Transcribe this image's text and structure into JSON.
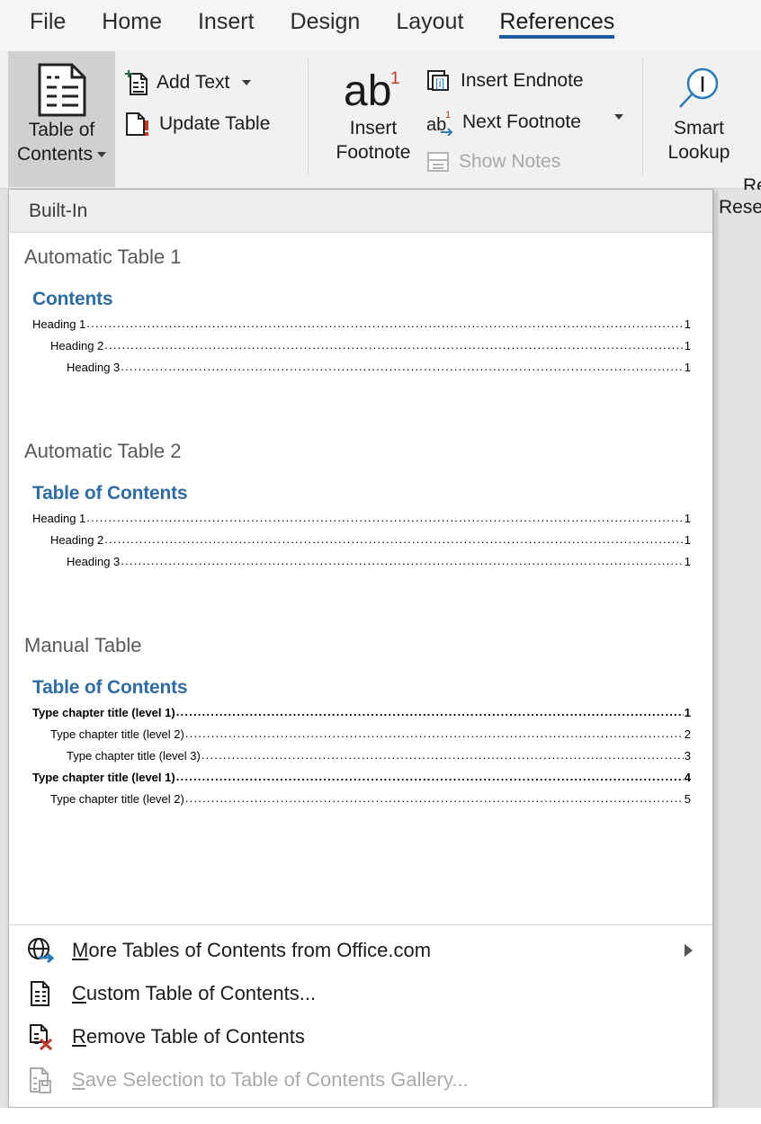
{
  "ribbon": {
    "tabs": [
      {
        "label": "File",
        "active": false
      },
      {
        "label": "Home",
        "active": false
      },
      {
        "label": "Insert",
        "active": false
      },
      {
        "label": "Design",
        "active": false
      },
      {
        "label": "Layout",
        "active": false
      },
      {
        "label": "References",
        "active": true
      }
    ],
    "accent_color": "#2058a8",
    "toc_button": {
      "line1": "Table of",
      "line2": "Contents",
      "icon": "table-of-contents-icon",
      "pressed": true
    },
    "toc_group": {
      "add_text": "Add Text",
      "add_text_icon": "add-text-icon",
      "update_table": "Update Table",
      "update_table_icon": "update-table-icon"
    },
    "footnotes_group": {
      "insert_footnote_line1": "Insert",
      "insert_footnote_line2": "Footnote",
      "insert_footnote_icon": "insert-footnote-icon",
      "insert_endnote": "Insert Endnote",
      "insert_endnote_icon": "insert-endnote-icon",
      "next_footnote": "Next Footnote",
      "next_footnote_icon": "next-footnote-icon",
      "show_notes": "Show Notes",
      "show_notes_icon": "show-notes-icon",
      "show_notes_disabled": true
    },
    "research_group": {
      "smart_lookup_line1": "Smart",
      "smart_lookup_line2": "Lookup",
      "smart_lookup_icon": "smart-lookup-icon",
      "clipped_label": "Re",
      "pane_clipped_label": "Resea"
    }
  },
  "dropdown": {
    "header": "Built-In",
    "gallery": [
      {
        "title": "Automatic Table 1",
        "heading": "Contents",
        "entries": [
          {
            "text": "Heading 1",
            "page": "1",
            "level": 1,
            "bold": false
          },
          {
            "text": "Heading 2",
            "page": "1",
            "level": 2,
            "bold": false
          },
          {
            "text": "Heading 3",
            "page": "1",
            "level": 3,
            "bold": false
          }
        ]
      },
      {
        "title": "Automatic Table 2",
        "heading": "Table of Contents",
        "entries": [
          {
            "text": "Heading 1",
            "page": "1",
            "level": 1,
            "bold": false
          },
          {
            "text": "Heading 2",
            "page": "1",
            "level": 2,
            "bold": false
          },
          {
            "text": "Heading 3",
            "page": "1",
            "level": 3,
            "bold": false
          }
        ]
      },
      {
        "title": "Manual Table",
        "heading": "Table of Contents",
        "entries": [
          {
            "text": "Type chapter title (level 1)",
            "page": "1",
            "level": 1,
            "bold": true
          },
          {
            "text": "Type chapter title (level 2)",
            "page": "2",
            "level": 2,
            "bold": false
          },
          {
            "text": "Type chapter title (level 3)",
            "page": "3",
            "level": 3,
            "bold": false
          },
          {
            "text": "Type chapter title (level 1)",
            "page": "4",
            "level": 1,
            "bold": true
          },
          {
            "text": "Type chapter title (level 2)",
            "page": "5",
            "level": 2,
            "bold": false
          }
        ]
      }
    ],
    "menu_items": [
      {
        "accel": "M",
        "rest": "ore Tables of Contents from Office.com",
        "icon": "office-online-globe-icon",
        "disabled": false,
        "submenu": true
      },
      {
        "accel": "C",
        "rest": "ustom Table of Contents...",
        "icon": "custom-table-of-contents-icon",
        "disabled": false,
        "submenu": false
      },
      {
        "accel": "R",
        "rest": "emove Table of Contents",
        "icon": "remove-table-of-contents-icon",
        "disabled": false,
        "submenu": false
      },
      {
        "accel": "S",
        "rest": "ave Selection to Table of Contents Gallery...",
        "icon": "save-selection-to-gallery-icon",
        "disabled": true,
        "submenu": false
      }
    ]
  }
}
